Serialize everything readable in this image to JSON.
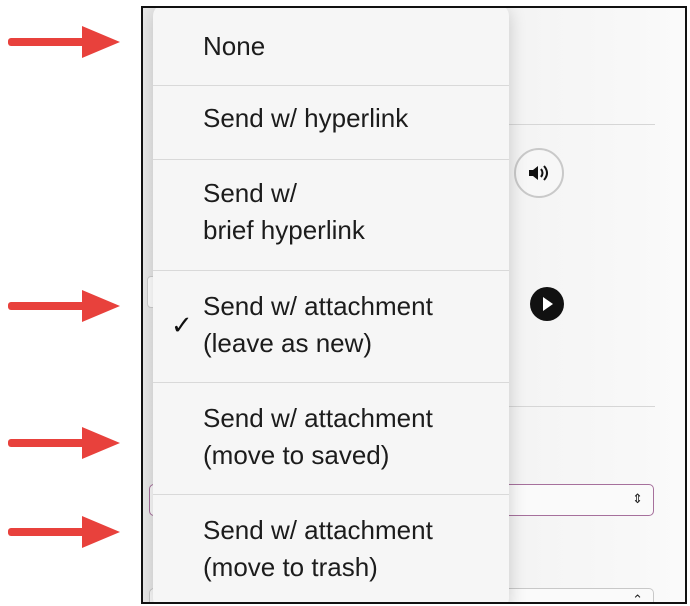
{
  "menu": {
    "items": [
      {
        "label": "None",
        "checked": false
      },
      {
        "label": "Send w/ hyperlink",
        "checked": false
      },
      {
        "label": "Send w/\nbrief hyperlink",
        "checked": false
      },
      {
        "label": "Send w/ attachment\n(leave as new)",
        "checked": true
      },
      {
        "label": "Send w/ attachment\n(move to saved)",
        "checked": false
      },
      {
        "label": "Send w/ attachment\n(move to trash)",
        "checked": false
      }
    ],
    "check_glyph": "✓"
  },
  "background": {
    "speaker_icon": "speaker-icon",
    "play_icon": "play-icon",
    "select_chevron": "⌃⌄"
  },
  "colors": {
    "arrow": "#e8413c",
    "menu_bg": "#f6f6f6",
    "select_border": "#a6709c"
  }
}
